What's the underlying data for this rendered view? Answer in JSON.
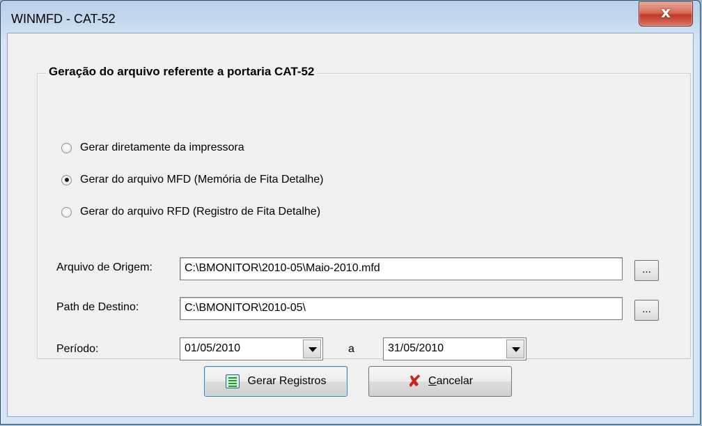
{
  "window": {
    "title": "WINMFD - CAT-52",
    "close_glyph": "x"
  },
  "group": {
    "title": "Geração do arquivo referente a portaria CAT-52",
    "options": [
      {
        "label": "Gerar diretamente da impressora",
        "checked": false
      },
      {
        "label": "Gerar do arquivo MFD (Memória de Fita Detalhe)",
        "checked": true
      },
      {
        "label": "Gerar do arquivo RFD (Registro de Fita Detalhe)",
        "checked": false
      }
    ],
    "origem": {
      "label": "Arquivo de Origem:",
      "value": "C:\\BMONITOR\\2010-05\\Maio-2010.mfd",
      "browse": "..."
    },
    "destino": {
      "label": "Path de Destino:",
      "value": "C:\\BMONITOR\\2010-05\\",
      "browse": "..."
    },
    "periodo": {
      "label": "Período:",
      "start": "01/05/2010",
      "separator": "a",
      "end": "31/05/2010"
    }
  },
  "buttons": {
    "gerar": {
      "label": "Gerar Registros",
      "icon": "list-icon"
    },
    "cancelar": {
      "accel": "C",
      "label_rest": "ancelar",
      "icon": "x-icon"
    }
  }
}
